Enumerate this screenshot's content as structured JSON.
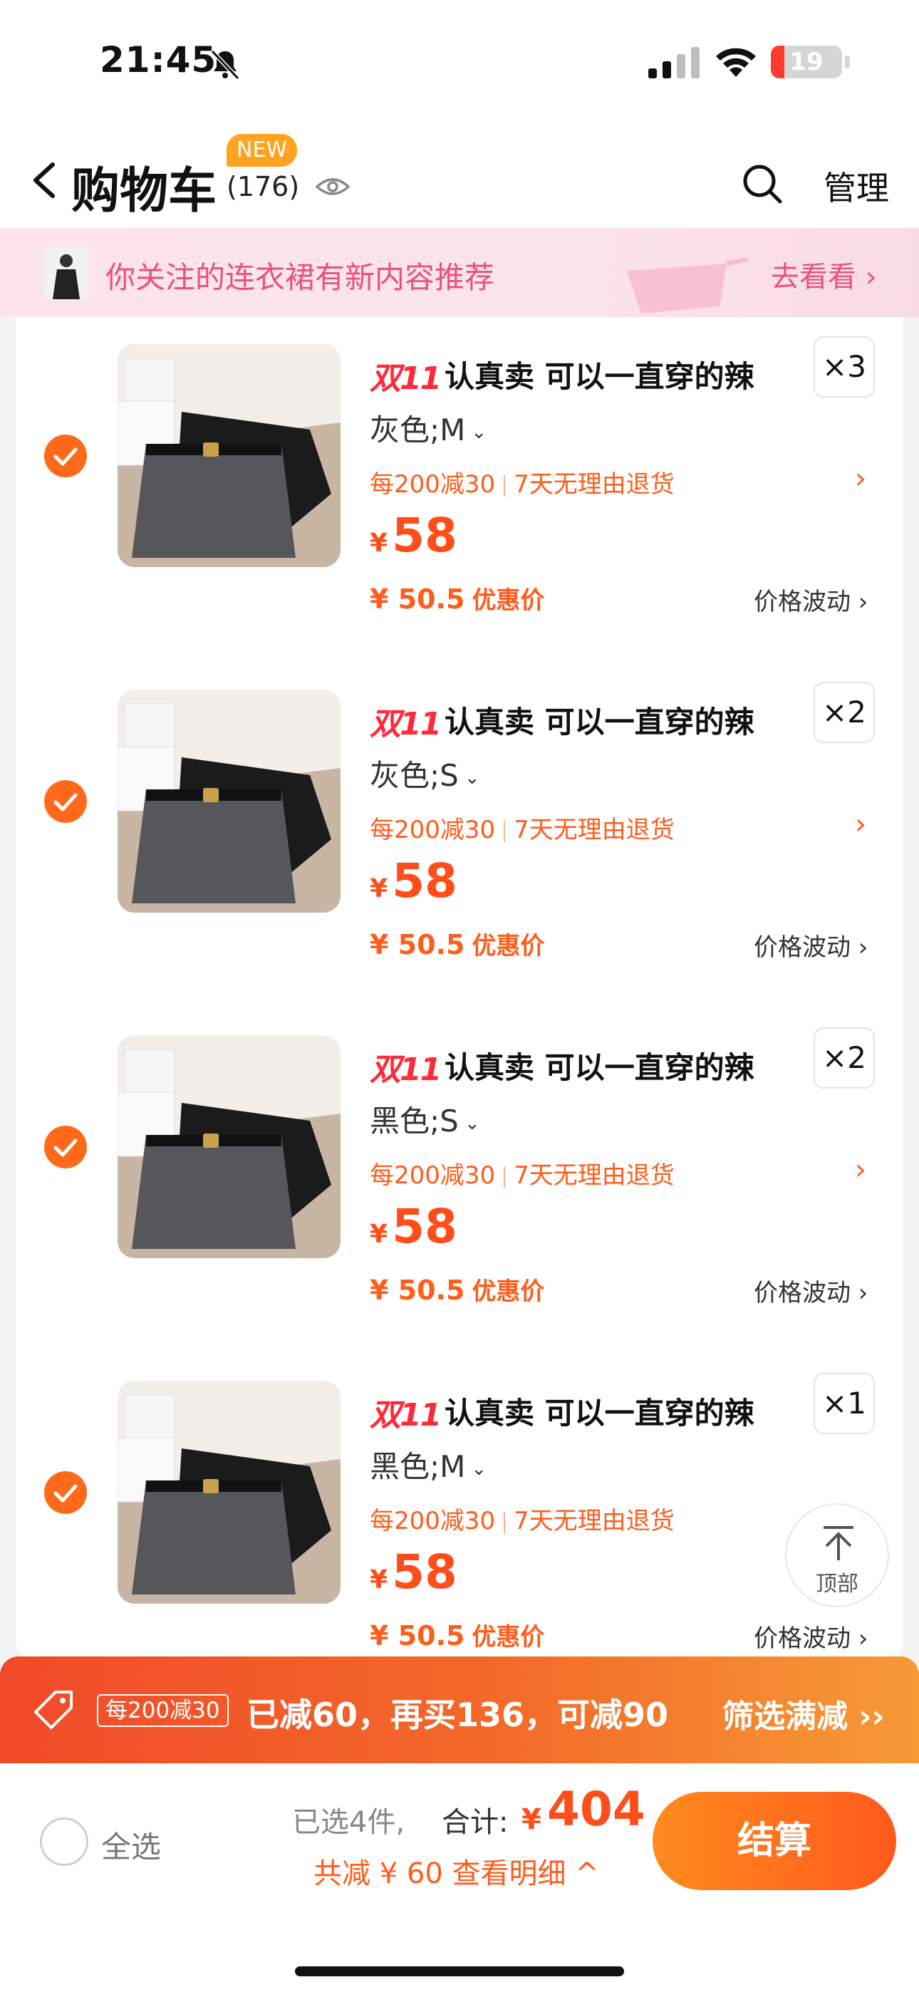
{
  "status": {
    "time": "21:45",
    "battery": "19",
    "battery_level": 0.19
  },
  "nav": {
    "title": "购物车",
    "count": "(176)",
    "new_badge": "NEW",
    "manage": "管理"
  },
  "banner": {
    "text": "你关注的连衣裙有新内容推荐",
    "link": "去看看 ›"
  },
  "items": [
    {
      "tag": "双11",
      "name": "认真卖 可以一直穿的辣",
      "qty": "×3",
      "sku": "灰色;M",
      "promo1": "每200减30",
      "promo2": "7天无理由退货",
      "currency": "¥",
      "price": "58",
      "dprice": "¥ 50.5",
      "dprice_label": "优惠价",
      "fluct": "价格波动 ›"
    },
    {
      "tag": "双11",
      "name": "认真卖 可以一直穿的辣",
      "qty": "×2",
      "sku": "灰色;S",
      "promo1": "每200减30",
      "promo2": "7天无理由退货",
      "currency": "¥",
      "price": "58",
      "dprice": "¥ 50.5",
      "dprice_label": "优惠价",
      "fluct": "价格波动 ›"
    },
    {
      "tag": "双11",
      "name": "认真卖 可以一直穿的辣",
      "qty": "×2",
      "sku": "黑色;S",
      "promo1": "每200减30",
      "promo2": "7天无理由退货",
      "currency": "¥",
      "price": "58",
      "dprice": "¥ 50.5",
      "dprice_label": "优惠价",
      "fluct": "价格波动 ›"
    },
    {
      "tag": "双11",
      "name": "认真卖 可以一直穿的辣",
      "qty": "×1",
      "sku": "黑色;M",
      "promo1": "每200减30",
      "promo2": "7天无理由退货",
      "currency": "¥",
      "price": "58",
      "dprice": "¥ 50.5",
      "dprice_label": "优惠价",
      "fluct": "价格波动 ›"
    }
  ],
  "top_button": "顶部",
  "discount_bar": {
    "chip": "每200减30",
    "message": "已减60，再买136，可减90",
    "filter": "筛选满减 ››"
  },
  "bottom": {
    "select_all": "全选",
    "selected": "已选4件,",
    "total_label": "合计:",
    "currency": "¥",
    "total": "404",
    "saved": "共减 ¥ 60  查看明细 ^",
    "checkout": "结算"
  },
  "colors": {
    "accent": "#ff5d1c",
    "price": "#ff4e1a",
    "banner_text": "#e8527d",
    "tag11": "#ff2a3a"
  }
}
